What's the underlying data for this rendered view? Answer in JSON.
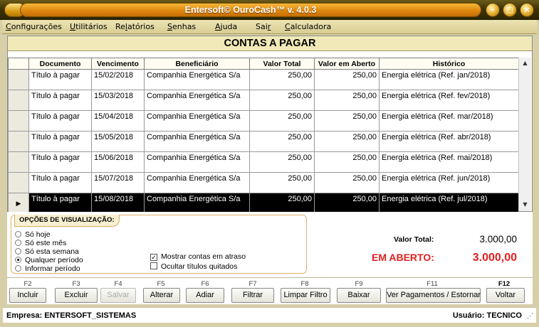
{
  "window": {
    "title": "Entersoft© OuroCash™ v. 4.0.3",
    "title_buttons": [
      "minimize-icon",
      "maximize-icon",
      "close-icon"
    ]
  },
  "menu": [
    {
      "label": "Configurações"
    },
    {
      "label": "Utilitários"
    },
    {
      "label": "Relatórios"
    },
    {
      "label": "Senhas"
    },
    {
      "label": "Ajuda"
    },
    {
      "label": "Sair"
    },
    {
      "label": "Calculadora"
    }
  ],
  "grid": {
    "title": "CONTAS A PAGAR",
    "columns": [
      "Documento",
      "Vencimento",
      "Beneficiário",
      "Valor Total",
      "Valor em Aberto",
      "Histórico"
    ],
    "rows": [
      {
        "documento": "Título à pagar",
        "vencimento": "15/02/2018",
        "beneficiario": "Companhia Energética S/a",
        "valor_total": "250,00",
        "valor_aberto": "250,00",
        "historico": "Energia elétrica (Ref. jan/2018)"
      },
      {
        "documento": "Título à pagar",
        "vencimento": "15/03/2018",
        "beneficiario": "Companhia Energética S/a",
        "valor_total": "250,00",
        "valor_aberto": "250,00",
        "historico": "Energia elétrica (Ref. fev/2018)"
      },
      {
        "documento": "Título à pagar",
        "vencimento": "15/04/2018",
        "beneficiario": "Companhia Energética S/a",
        "valor_total": "250,00",
        "valor_aberto": "250,00",
        "historico": "Energia elétrica (Ref. mar/2018)"
      },
      {
        "documento": "Título à pagar",
        "vencimento": "15/05/2018",
        "beneficiario": "Companhia Energética S/a",
        "valor_total": "250,00",
        "valor_aberto": "250,00",
        "historico": "Energia elétrica (Ref. abr/2018)"
      },
      {
        "documento": "Título à pagar",
        "vencimento": "15/06/2018",
        "beneficiario": "Companhia Energética S/a",
        "valor_total": "250,00",
        "valor_aberto": "250,00",
        "historico": "Energia elétrica (Ref. mai/2018)"
      },
      {
        "documento": "Título à pagar",
        "vencimento": "15/07/2018",
        "beneficiario": "Companhia Energética S/a",
        "valor_total": "250,00",
        "valor_aberto": "250,00",
        "historico": "Energia elétrica (Ref. jun/2018)"
      },
      {
        "documento": "Título à pagar",
        "vencimento": "15/08/2018",
        "beneficiario": "Companhia Energética S/a",
        "valor_total": "250,00",
        "valor_aberto": "250,00",
        "historico": "Energia elétrica (Ref. jul/2018)"
      }
    ],
    "selected_row": 6,
    "row_pointer_icon": "row-pointer-icon"
  },
  "options": {
    "title": "OPÇÕES DE VISUALIZAÇÃO:",
    "radios": [
      {
        "label": "Só hoje",
        "checked": false
      },
      {
        "label": "Só este mês",
        "checked": false
      },
      {
        "label": "Só esta semana",
        "checked": false
      },
      {
        "label": "Qualquer período",
        "checked": true
      },
      {
        "label": "Informar período",
        "checked": false
      }
    ],
    "checkboxes": [
      {
        "label": "Mostrar contas em atraso",
        "checked": true,
        "mark": "✓"
      },
      {
        "label": "Ocultar títulos quitados",
        "checked": false,
        "mark": ""
      }
    ]
  },
  "totals": {
    "total_label": "Valor Total:",
    "total_value": "3.000,00",
    "open_label": "EM ABERTO:",
    "open_value": "3.000,00",
    "open_color": "#e02020"
  },
  "fkeys": [
    {
      "key": "F2",
      "label": "Incluir",
      "enabled": true
    },
    {
      "key": "F3",
      "label": "Excluir",
      "enabled": true
    },
    {
      "key": "F4",
      "label": "Salvar",
      "enabled": false
    },
    {
      "key": "F5",
      "label": "Alterar",
      "enabled": true
    },
    {
      "key": "F6",
      "label": "Adiar",
      "enabled": true
    },
    {
      "key": "F7",
      "label": "Filtrar",
      "enabled": true
    },
    {
      "key": "F8",
      "label": "Limpar Filtro",
      "enabled": true
    },
    {
      "key": "F9",
      "label": "Baixar",
      "enabled": true
    },
    {
      "key": "F11",
      "label": "Ver Pagamentos / Estornar",
      "enabled": true
    },
    {
      "key": "F12",
      "label": "Voltar",
      "enabled": true
    }
  ],
  "status": {
    "empresa": "Empresa: ENTERSOFT_SISTEMAS",
    "usuario": "Usuário: TECNICO"
  }
}
